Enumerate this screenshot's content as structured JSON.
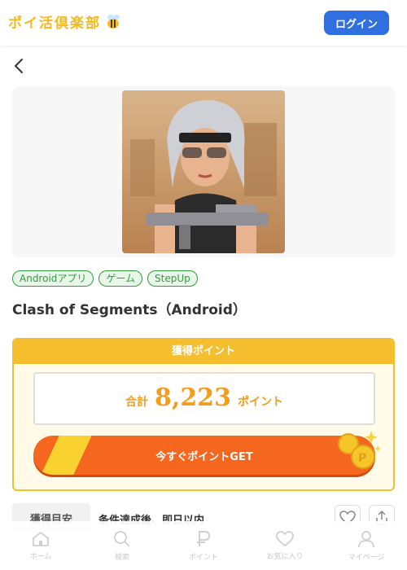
{
  "header": {
    "logo_text": "ポイ活倶楽部",
    "login_label": "ログイン"
  },
  "tags": [
    "Androidアプリ",
    "ゲーム",
    "StepUp"
  ],
  "app": {
    "title": "Clash of Segments（Android）"
  },
  "points": {
    "header": "獲得ポイント",
    "total_label": "合計",
    "total_value": "8,223",
    "unit": "ポイント",
    "cta_label": "今すぐポイントGET"
  },
  "info": {
    "label": "獲得目安",
    "value": "条件達成後、即日以内"
  },
  "bottom_nav": {
    "items": [
      {
        "label": "ホーム",
        "icon": "home-icon"
      },
      {
        "label": "検索",
        "icon": "search-icon"
      },
      {
        "label": "ポイント",
        "icon": "point-icon"
      },
      {
        "label": "お気に入り",
        "icon": "heart-icon"
      },
      {
        "label": "マイページ",
        "icon": "user-icon"
      }
    ]
  },
  "colors": {
    "brand_yellow": "#f5be2e",
    "cta_orange": "#f5671f",
    "login_blue": "#2f6fe0",
    "tag_green": "#2e9e3a"
  }
}
